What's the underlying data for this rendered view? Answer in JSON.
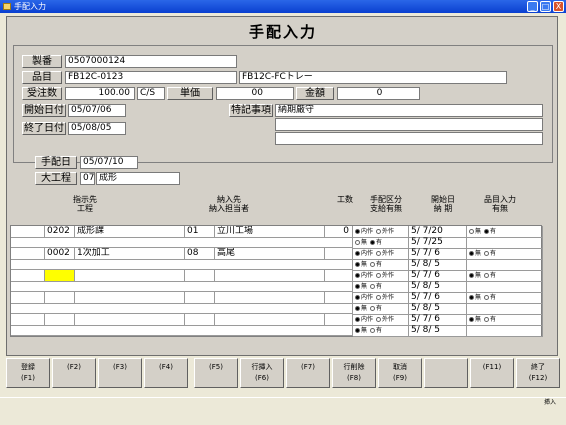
{
  "window": {
    "title": "手配入力",
    "minimize": "_",
    "maximize": "□",
    "close": "X"
  },
  "form_title": "手配入力",
  "header": {
    "seiban_label": "製番",
    "seiban_value": "0507000124",
    "hinmoku_label": "品目",
    "hinmoku_code": "FB12C-0123",
    "hinmoku_name": "FB12C-FCトレー",
    "juchusu_label": "受注数",
    "juchusu_value": "100.00",
    "unit_value": "C/S",
    "tanka_label": "単価",
    "tanka_value": "00",
    "kingaku_label": "金額",
    "kingaku_value": "0",
    "start_label": "開始日付",
    "start_value": "05/07/06",
    "end_label": "終了日付",
    "end_value": "05/08/05",
    "note_label": "特記事項",
    "note_line1": "納期厳守",
    "note_line2": "",
    "note_line3": ""
  },
  "tehai": {
    "date_label": "手配日",
    "date_value": "05/07/10",
    "process_label": "大工程",
    "process_code": "07",
    "process_name": "成形"
  },
  "columns": {
    "shiji_1": "指示先",
    "shiji_2": "工程",
    "nonyu_1": "納入先",
    "nonyu_2": "納入担当者",
    "kosu": "工数",
    "kubun_1": "手配区分",
    "kubun_2": "支給有無",
    "date_1": "開始日",
    "date_2": "納 期",
    "hinmoku_1": "品目入力",
    "hinmoku_2": "有無"
  },
  "radio_labels": {
    "naisaku": "内作",
    "gaisaku": "外作",
    "mu": "無",
    "yu": "有"
  },
  "rows": [
    {
      "shiji_code": "0202",
      "shiji_name": "成形課",
      "nonyu_code": "01",
      "nonyu_name": "立川工場",
      "kosu": "0",
      "tehai": "内作",
      "shikyu": "有",
      "start": "5/ 7/20",
      "due": "5/ 7/25",
      "hinmoku": "有"
    },
    {
      "shiji_code": "0002",
      "shiji_name": "1次加工",
      "nonyu_code": "08",
      "nonyu_name": "高尾",
      "kosu": "",
      "tehai": "内作",
      "shikyu": "無",
      "start": "5/ 7/ 6",
      "due": "5/ 8/ 5",
      "hinmoku": "無"
    },
    {
      "shiji_code": "",
      "shiji_name": "",
      "nonyu_code": "",
      "nonyu_name": "",
      "kosu": "",
      "tehai": "内作",
      "shikyu": "無",
      "start": "5/ 7/ 6",
      "due": "5/ 8/ 5",
      "hinmoku": "無"
    },
    {
      "shiji_code": "",
      "shiji_name": "",
      "nonyu_code": "",
      "nonyu_name": "",
      "kosu": "",
      "tehai": "内作",
      "shikyu": "無",
      "start": "5/ 7/ 6",
      "due": "5/ 8/ 5",
      "hinmoku": "無"
    },
    {
      "shiji_code": "",
      "shiji_name": "",
      "nonyu_code": "",
      "nonyu_name": "",
      "kosu": "",
      "tehai": "内作",
      "shikyu": "無",
      "start": "5/ 7/ 6",
      "due": "5/ 8/ 5",
      "hinmoku": "無"
    }
  ],
  "fkeys": [
    {
      "label": "登録",
      "key": "(F1)"
    },
    {
      "label": "",
      "key": "(F2)"
    },
    {
      "label": "",
      "key": "(F3)"
    },
    {
      "label": "",
      "key": "(F4)"
    },
    {
      "label": "",
      "key": "(F5)"
    },
    {
      "label": "行挿入",
      "key": "(F6)"
    },
    {
      "label": "",
      "key": "(F7)"
    },
    {
      "label": "行削除",
      "key": "(F8)"
    },
    {
      "label": "取消",
      "key": "(F9)"
    },
    {
      "label": "",
      "key": ""
    },
    {
      "label": "",
      "key": "(F11)"
    },
    {
      "label": "終了",
      "key": "(F12)"
    }
  ],
  "status": {
    "mode": "挿入"
  }
}
